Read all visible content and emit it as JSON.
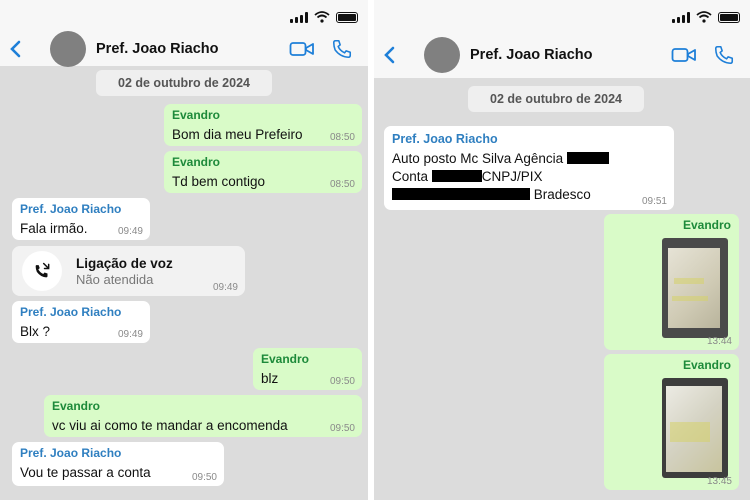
{
  "left": {
    "contact_name": "Pref. Joao Riacho",
    "date": "02 de outubro de 2024",
    "messages": [
      {
        "sender": "Evandro",
        "text": "Bom dia meu Prefeiro",
        "time": "08:50"
      },
      {
        "sender": "Evandro",
        "text": "Td bem contigo",
        "time": "08:50"
      },
      {
        "sender": "Pref. Joao Riacho",
        "text": "Fala irmão.",
        "time": "09:49"
      },
      {
        "call_title": "Ligação de voz",
        "call_status": "Não atendida",
        "time": "09:49"
      },
      {
        "sender": "Pref. Joao Riacho",
        "text": "Blx ?",
        "time": "09:49"
      },
      {
        "sender": "Evandro",
        "text": "blz",
        "time": "09:50"
      },
      {
        "sender": "Evandro",
        "text": "vc viu ai como te mandar a encomenda",
        "time": "09:50"
      },
      {
        "sender": "Pref. Joao Riacho",
        "text": "Vou te passar a conta",
        "time": "09:50"
      }
    ]
  },
  "right": {
    "contact_name": "Pref. Joao Riacho",
    "date": "02 de outubro de 2024",
    "messages": [
      {
        "sender": "Pref. Joao Riacho",
        "line1": "Auto posto Mc Silva Agência",
        "line2a": "Conta",
        "line2b": "CNPJ/PIX",
        "line3": "Bradesco",
        "time": "09:51"
      },
      {
        "sender": "Evandro",
        "time": "13:44",
        "media": "photo"
      },
      {
        "sender": "Evandro",
        "time": "13:45",
        "media": "photo"
      }
    ]
  },
  "colors": {
    "chat_background": "#dcdcdc",
    "outgoing_bubble": "#d9fbc8",
    "incoming_bubble": "#ffffff",
    "accent_blue": "#1e7fd8",
    "outgoing_sender": "#1d8a3a",
    "incoming_sender": "#2f7fc0"
  },
  "icons": [
    "back-chevron-icon",
    "video-call-icon",
    "phone-icon",
    "missed-call-icon",
    "signal-icon",
    "wifi-icon",
    "battery-icon"
  ]
}
